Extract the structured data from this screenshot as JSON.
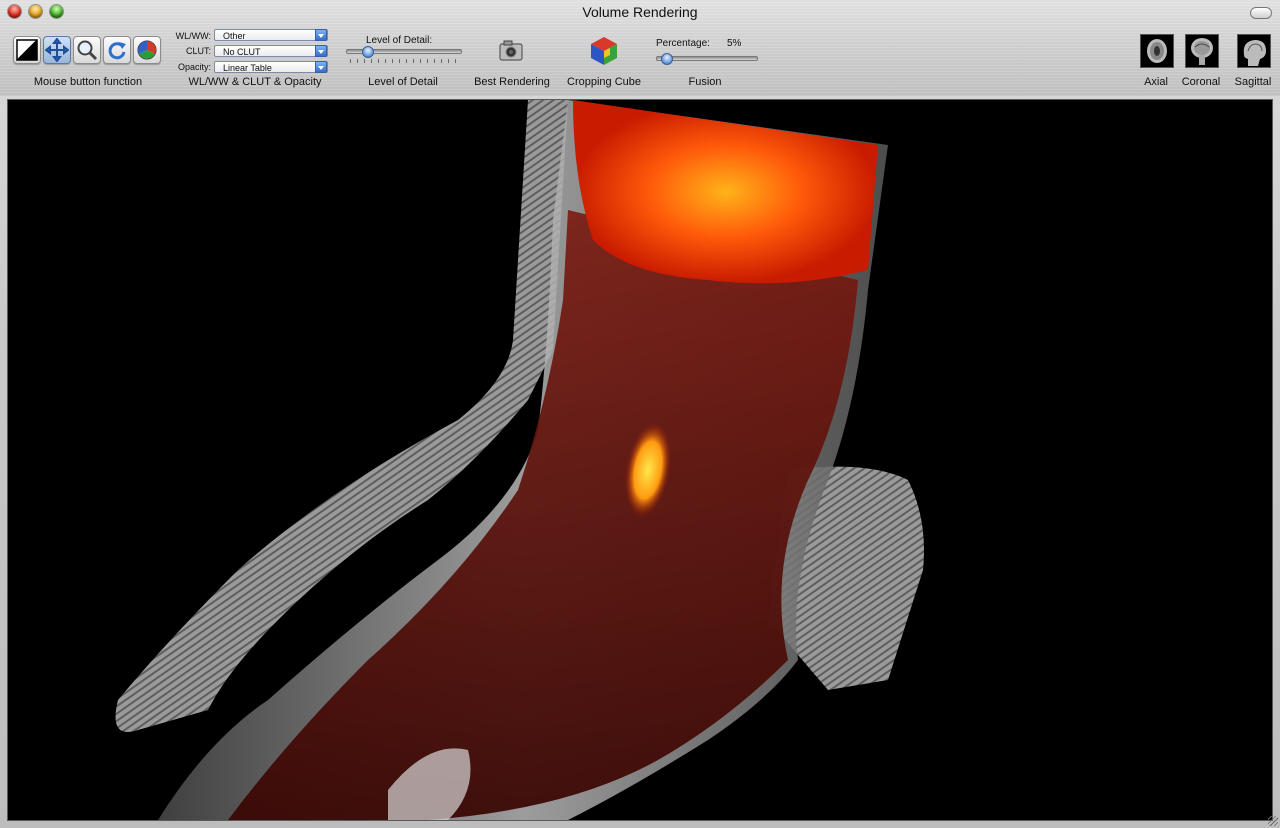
{
  "window": {
    "title": "Volume Rendering"
  },
  "toolbar": {
    "mouse_button_function_label": "Mouse button function",
    "mouse_tools": [
      {
        "name": "wl-ww-tool",
        "icon": "contrast-icon",
        "active": false
      },
      {
        "name": "pan-tool",
        "icon": "move-arrows-icon",
        "active": true
      },
      {
        "name": "zoom-tool",
        "icon": "magnifier-icon",
        "active": false
      },
      {
        "name": "rotate-tool",
        "icon": "rotate-icon",
        "active": false
      },
      {
        "name": "3d-rotate-tool",
        "icon": "3d-axes-icon",
        "active": false
      }
    ],
    "wlww_group_label": "WL/WW & CLUT & Opacity",
    "wlww_label": "WL/WW:",
    "wlww_value": "Other",
    "clut_label": "CLUT:",
    "clut_value": "No CLUT",
    "opacity_label": "Opacity:",
    "opacity_value": "Linear Table",
    "level_of_detail_title": "Level of Detail:",
    "level_of_detail_label": "Level of Detail",
    "level_of_detail_fraction": 0.15,
    "best_rendering_label": "Best Rendering",
    "cropping_cube_label": "Cropping Cube",
    "fusion_label": "Fusion",
    "percentage_label": "Percentage:",
    "percentage_value": "5%",
    "percentage_fraction": 0.05,
    "views": [
      {
        "label": "Axial",
        "icon": "axial-brain-icon"
      },
      {
        "label": "Coronal",
        "icon": "coronal-brain-icon"
      },
      {
        "label": "Sagittal",
        "icon": "sagittal-brain-icon"
      }
    ]
  }
}
